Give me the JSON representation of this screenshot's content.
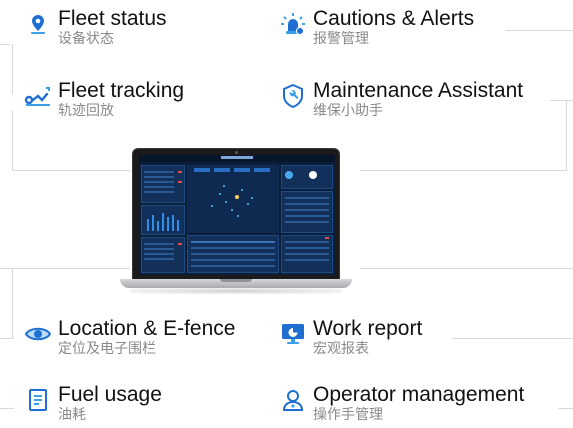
{
  "features": {
    "fleet_status": {
      "title": "Fleet status",
      "subtitle": "设备状态",
      "icon": "location-pin-icon"
    },
    "cautions_alerts": {
      "title": "Cautions & Alerts",
      "subtitle": "报警管理",
      "icon": "alarm-light-icon"
    },
    "fleet_tracking": {
      "title": "Fleet tracking",
      "subtitle": "轨迹回放",
      "icon": "route-icon"
    },
    "maintenance_assistant": {
      "title": "Maintenance Assistant",
      "subtitle": "维保小助手",
      "icon": "wrench-shield-icon"
    },
    "location_efence": {
      "title": "Location & E-fence",
      "subtitle": "定位及电子围栏",
      "icon": "eye-icon"
    },
    "work_report": {
      "title": "Work report",
      "subtitle": "宏观报表",
      "icon": "monitor-report-icon"
    },
    "fuel_usage": {
      "title": "Fuel usage",
      "subtitle": "油耗",
      "icon": "fuel-document-icon"
    },
    "operator_management": {
      "title": "Operator management",
      "subtitle": "操作手管理",
      "icon": "operator-icon"
    }
  },
  "colors": {
    "accent": "#1f6fd1",
    "accent_light": "#3aa0e8",
    "text": "#111111",
    "subtext": "#8a8a8a",
    "line": "#d9d9d9",
    "alert": "#e34a4a"
  }
}
